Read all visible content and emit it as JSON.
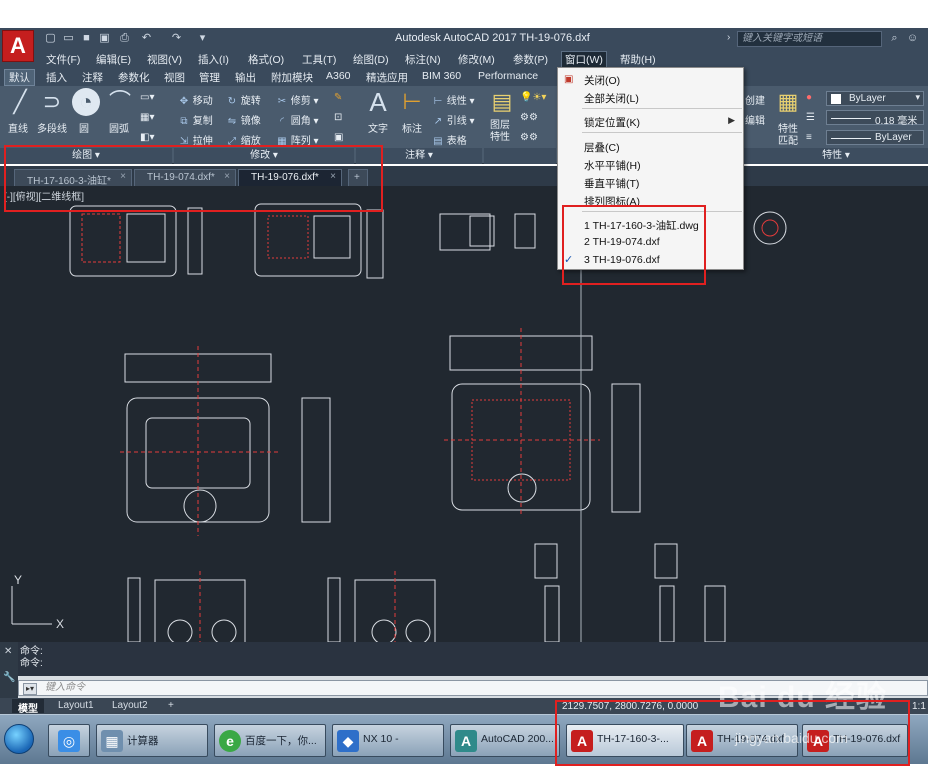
{
  "title_bar": {
    "app_title": "Autodesk AutoCAD 2017    TH-19-076.dxf",
    "search_placeholder": "键入关键字或短语",
    "app_button_letter": "A"
  },
  "menu_bar": {
    "items": [
      "文件(F)",
      "编辑(E)",
      "视图(V)",
      "插入(I)",
      "格式(O)",
      "工具(T)",
      "绘图(D)",
      "标注(N)",
      "修改(M)",
      "参数(P)",
      "窗口(W)",
      "帮助(H)"
    ],
    "active": "窗口(W)"
  },
  "ribbon_tabs": {
    "items": [
      "默认",
      "插入",
      "注释",
      "参数化",
      "视图",
      "管理",
      "输出",
      "附加模块",
      "A360",
      "精选应用",
      "BIM 360",
      "Performance"
    ],
    "active": "默认"
  },
  "ribbon": {
    "draw_tools": [
      "直线",
      "多段线",
      "圆",
      "圆弧"
    ],
    "modify_tools": [
      "移动",
      "旋转",
      "修剪",
      "复制",
      "镜像",
      "圆角",
      "拉伸",
      "缩放",
      "阵列"
    ],
    "annotation_tools": [
      "文字",
      "标注",
      "线性",
      "引线",
      "表格"
    ],
    "layer_label": "图层\n特性",
    "block_tools": [
      "创建",
      "编辑"
    ],
    "properties_tools": [
      "特性",
      "匹配"
    ],
    "bylayer_color": "ByLayer",
    "lineweight_value": "0.18 毫米",
    "linetype_value": "ByLayer",
    "panels": [
      "绘图",
      "修改",
      "注释",
      "特性"
    ]
  },
  "doc_tabs": {
    "items": [
      {
        "label": "TH-17-160-3-油缸*",
        "active": false
      },
      {
        "label": "TH-19-074.dxf*",
        "active": false
      },
      {
        "label": "TH-19-076.dxf*",
        "active": true
      }
    ],
    "add_label": "+"
  },
  "canvas": {
    "view_label": "[-][俯视][二维线框]",
    "axis_x": "X",
    "axis_y": "Y",
    "bg_color": "#212830",
    "line_color": "#d9dde3",
    "accent_color": "#e23b3b"
  },
  "window_menu": {
    "items": [
      {
        "label": "关闭(O)"
      },
      {
        "label": "全部关闭(L)"
      },
      {
        "label": "锁定位置(K)",
        "submenu": true
      },
      {
        "label": "层叠(C)"
      },
      {
        "label": "水平平铺(H)"
      },
      {
        "label": "垂直平铺(T)"
      },
      {
        "label": "排列图标(A)"
      },
      {
        "label": "1 TH-17-160-3-油缸.dwg"
      },
      {
        "label": "2 TH-19-074.dxf"
      },
      {
        "label": "3 TH-19-076.dxf",
        "checked": true
      }
    ]
  },
  "command": {
    "history": [
      "命令:",
      "命令:"
    ],
    "placeholder": "键入命令"
  },
  "layout_tabs": {
    "items": [
      "模型",
      "Layout1",
      "Layout2"
    ],
    "active": "模型",
    "add_label": "+"
  },
  "status": {
    "coordinates": "2129.7507, 2800.7276, 0.0000",
    "scale_label": "1:1"
  },
  "taskbar": {
    "items": [
      {
        "label": "计算器"
      },
      {
        "label": "百度一下，你..."
      },
      {
        "label": "NX 10 -"
      },
      {
        "label": "AutoCAD 200..."
      },
      {
        "label": "TH-17-160-3-..."
      },
      {
        "label": "TH-19-074.dxf"
      },
      {
        "label": "TH-19-076.dxf"
      }
    ]
  },
  "watermark": {
    "text": "Bai du 经验",
    "url": "jingyan.baidu.com"
  }
}
